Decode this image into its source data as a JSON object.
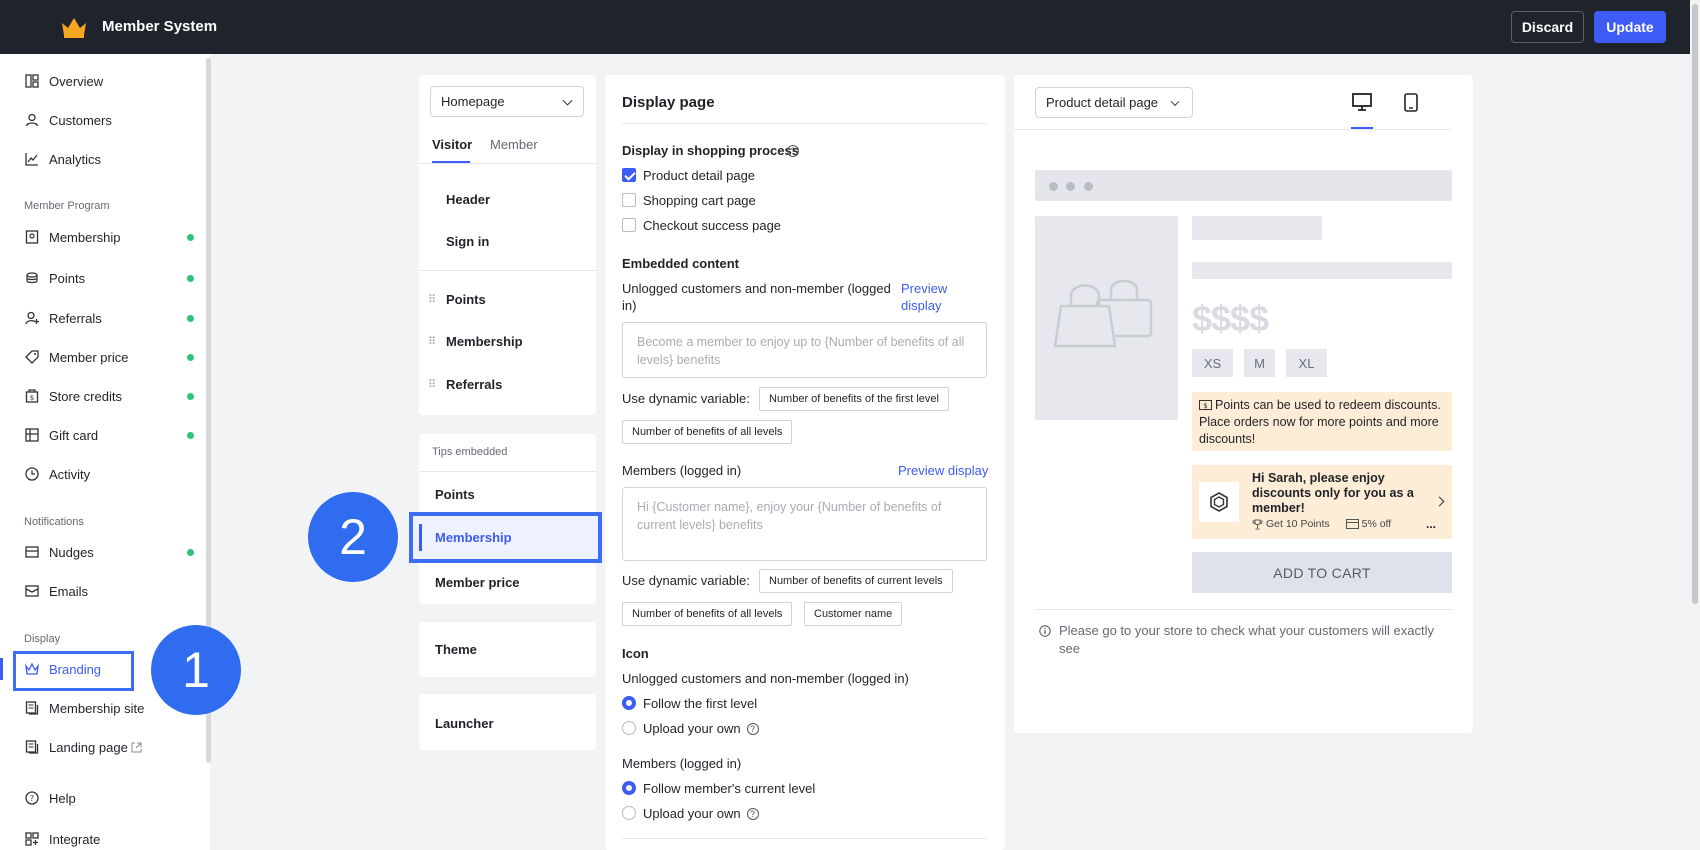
{
  "app": {
    "title": "Member System"
  },
  "topbar": {
    "discard_label": "Discard",
    "update_label": "Update"
  },
  "sidebar": {
    "items_top": [
      "Overview",
      "Customers",
      "Analytics"
    ],
    "section_member_program": "Member Program",
    "member_program": [
      "Membership",
      "Points",
      "Referrals",
      "Member price",
      "Store credits",
      "Gift card",
      "Activity"
    ],
    "section_notifications": "Notifications",
    "notifications": [
      "Nudges",
      "Emails"
    ],
    "section_display": "Display",
    "display": [
      "Branding",
      "Membership site",
      "Landing page"
    ],
    "bottom": [
      "Help",
      "Integrate"
    ]
  },
  "annotations": {
    "one": "1",
    "two": "2"
  },
  "editor": {
    "page_select": "Homepage",
    "tabs": [
      "Visitor",
      "Member"
    ],
    "items_a": [
      "Header",
      "Sign in"
    ],
    "items_b": [
      "Points",
      "Membership",
      "Referrals"
    ],
    "tips_label": "Tips embedded",
    "tips": [
      "Points",
      "Membership",
      "Member price"
    ],
    "theme": "Theme",
    "launcher": "Launcher"
  },
  "display": {
    "title": "Display page",
    "shopping_label": "Display in shopping process",
    "options": [
      "Product detail page",
      "Shopping cart page",
      "Checkout success page"
    ],
    "embedded_label": "Embedded content",
    "unlogged_label_1": "Unlogged customers and non-member (logged",
    "unlogged_label_2": "in)",
    "preview_1": "Preview",
    "preview_2": "display",
    "unlogged_placeholder": "Become a member to enjoy up to {Number of benefits of all levels} benefits",
    "dyn_label": "Use dynamic variable:",
    "chip_first_level": "Number of benefits of the first level",
    "chip_all_levels": "Number of benefits of all levels",
    "members_label": "Members (logged in)",
    "preview_display": "Preview display",
    "members_placeholder": "Hi {Customer name}, enjoy your {Number of benefits of current levels} benefits",
    "chip_current_levels": "Number of benefits of current levels",
    "chip_customer_name": "Customer name",
    "icon_label": "Icon",
    "icon_unlogged_label": "Unlogged customers and non-member (logged in)",
    "follow_first": "Follow the first level",
    "upload_own": "Upload your own",
    "icon_members_label": "Members (logged in)",
    "follow_current": "Follow member's current level"
  },
  "preview": {
    "page_select": "Product detail page",
    "price": "$$$$",
    "sizes": [
      "XS",
      "M",
      "XL"
    ],
    "points_text": "Points can be used to redeem discounts. Place orders now for more points and more discounts!",
    "member_text": "Hi Sarah, please enjoy discounts only for you as a member!",
    "get_points": "Get 10 Points",
    "discount": "5% off",
    "more": "...",
    "add_to_cart": "ADD TO CART",
    "note": "Please go to your store to check what your customers will exactly see"
  }
}
